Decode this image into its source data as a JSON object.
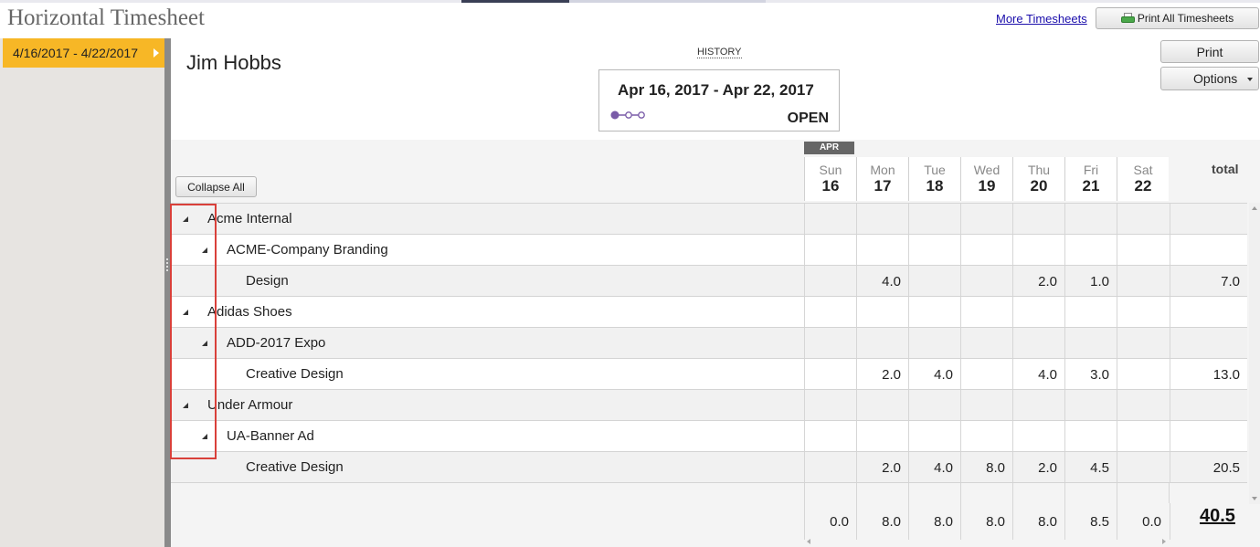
{
  "app": {
    "title": "Horizontal Timesheet"
  },
  "header": {
    "more_link": "More Timesheets",
    "print_all_label": "Print All Timesheets"
  },
  "actions": {
    "print_label": "Print",
    "options_label": "Options"
  },
  "sidebar": {
    "items": [
      {
        "label": "4/16/2017 - 4/22/2017"
      }
    ]
  },
  "employee": {
    "name": "Jim Hobbs"
  },
  "period": {
    "history_label": "HISTORY",
    "range": "Apr 16, 2017 - Apr 22, 2017",
    "status": "OPEN",
    "progress": {
      "steps": 3,
      "current": 1
    }
  },
  "grid": {
    "collapse_label": "Collapse All",
    "month": "APR",
    "days": [
      {
        "name": "Sun",
        "num": "16"
      },
      {
        "name": "Mon",
        "num": "17"
      },
      {
        "name": "Tue",
        "num": "18"
      },
      {
        "name": "Wed",
        "num": "19"
      },
      {
        "name": "Thu",
        "num": "20"
      },
      {
        "name": "Fri",
        "num": "21"
      },
      {
        "name": "Sat",
        "num": "22"
      }
    ],
    "total_label": "total",
    "rows": [
      {
        "level": 0,
        "label": "Acme Internal",
        "expand": true,
        "values": [
          "",
          "",
          "",
          "",
          "",
          "",
          ""
        ],
        "total": ""
      },
      {
        "level": 1,
        "label": "ACME-Company Branding",
        "expand": true,
        "values": [
          "",
          "",
          "",
          "",
          "",
          "",
          ""
        ],
        "total": ""
      },
      {
        "level": 2,
        "label": "Design",
        "expand": false,
        "values": [
          "",
          "4.0",
          "",
          "",
          "2.0",
          "1.0",
          ""
        ],
        "total": "7.0"
      },
      {
        "level": 0,
        "label": "Adidas Shoes",
        "expand": true,
        "values": [
          "",
          "",
          "",
          "",
          "",
          "",
          ""
        ],
        "total": ""
      },
      {
        "level": 1,
        "label": "ADD-2017 Expo",
        "expand": true,
        "values": [
          "",
          "",
          "",
          "",
          "",
          "",
          ""
        ],
        "total": ""
      },
      {
        "level": 2,
        "label": "Creative Design",
        "expand": false,
        "values": [
          "",
          "2.0",
          "4.0",
          "",
          "4.0",
          "3.0",
          ""
        ],
        "total": "13.0"
      },
      {
        "level": 0,
        "label": "Under Armour",
        "expand": true,
        "values": [
          "",
          "",
          "",
          "",
          "",
          "",
          ""
        ],
        "total": ""
      },
      {
        "level": 1,
        "label": "UA-Banner Ad",
        "expand": true,
        "values": [
          "",
          "",
          "",
          "",
          "",
          "",
          ""
        ],
        "total": ""
      },
      {
        "level": 2,
        "label": "Creative Design",
        "expand": false,
        "values": [
          "",
          "2.0",
          "4.0",
          "8.0",
          "2.0",
          "4.5",
          ""
        ],
        "total": "20.5"
      }
    ],
    "daily_totals": [
      "0.0",
      "8.0",
      "8.0",
      "8.0",
      "8.0",
      "8.5",
      "0.0"
    ],
    "grand_total": "40.5"
  },
  "colors": {
    "accent": "#f7b726",
    "highlight": "#d9403a",
    "progress": "#7a5ca8"
  },
  "icons": {
    "printer": "printer-icon",
    "expand": "expand-arrow-icon",
    "options_caret": "chevron-down-icon"
  }
}
